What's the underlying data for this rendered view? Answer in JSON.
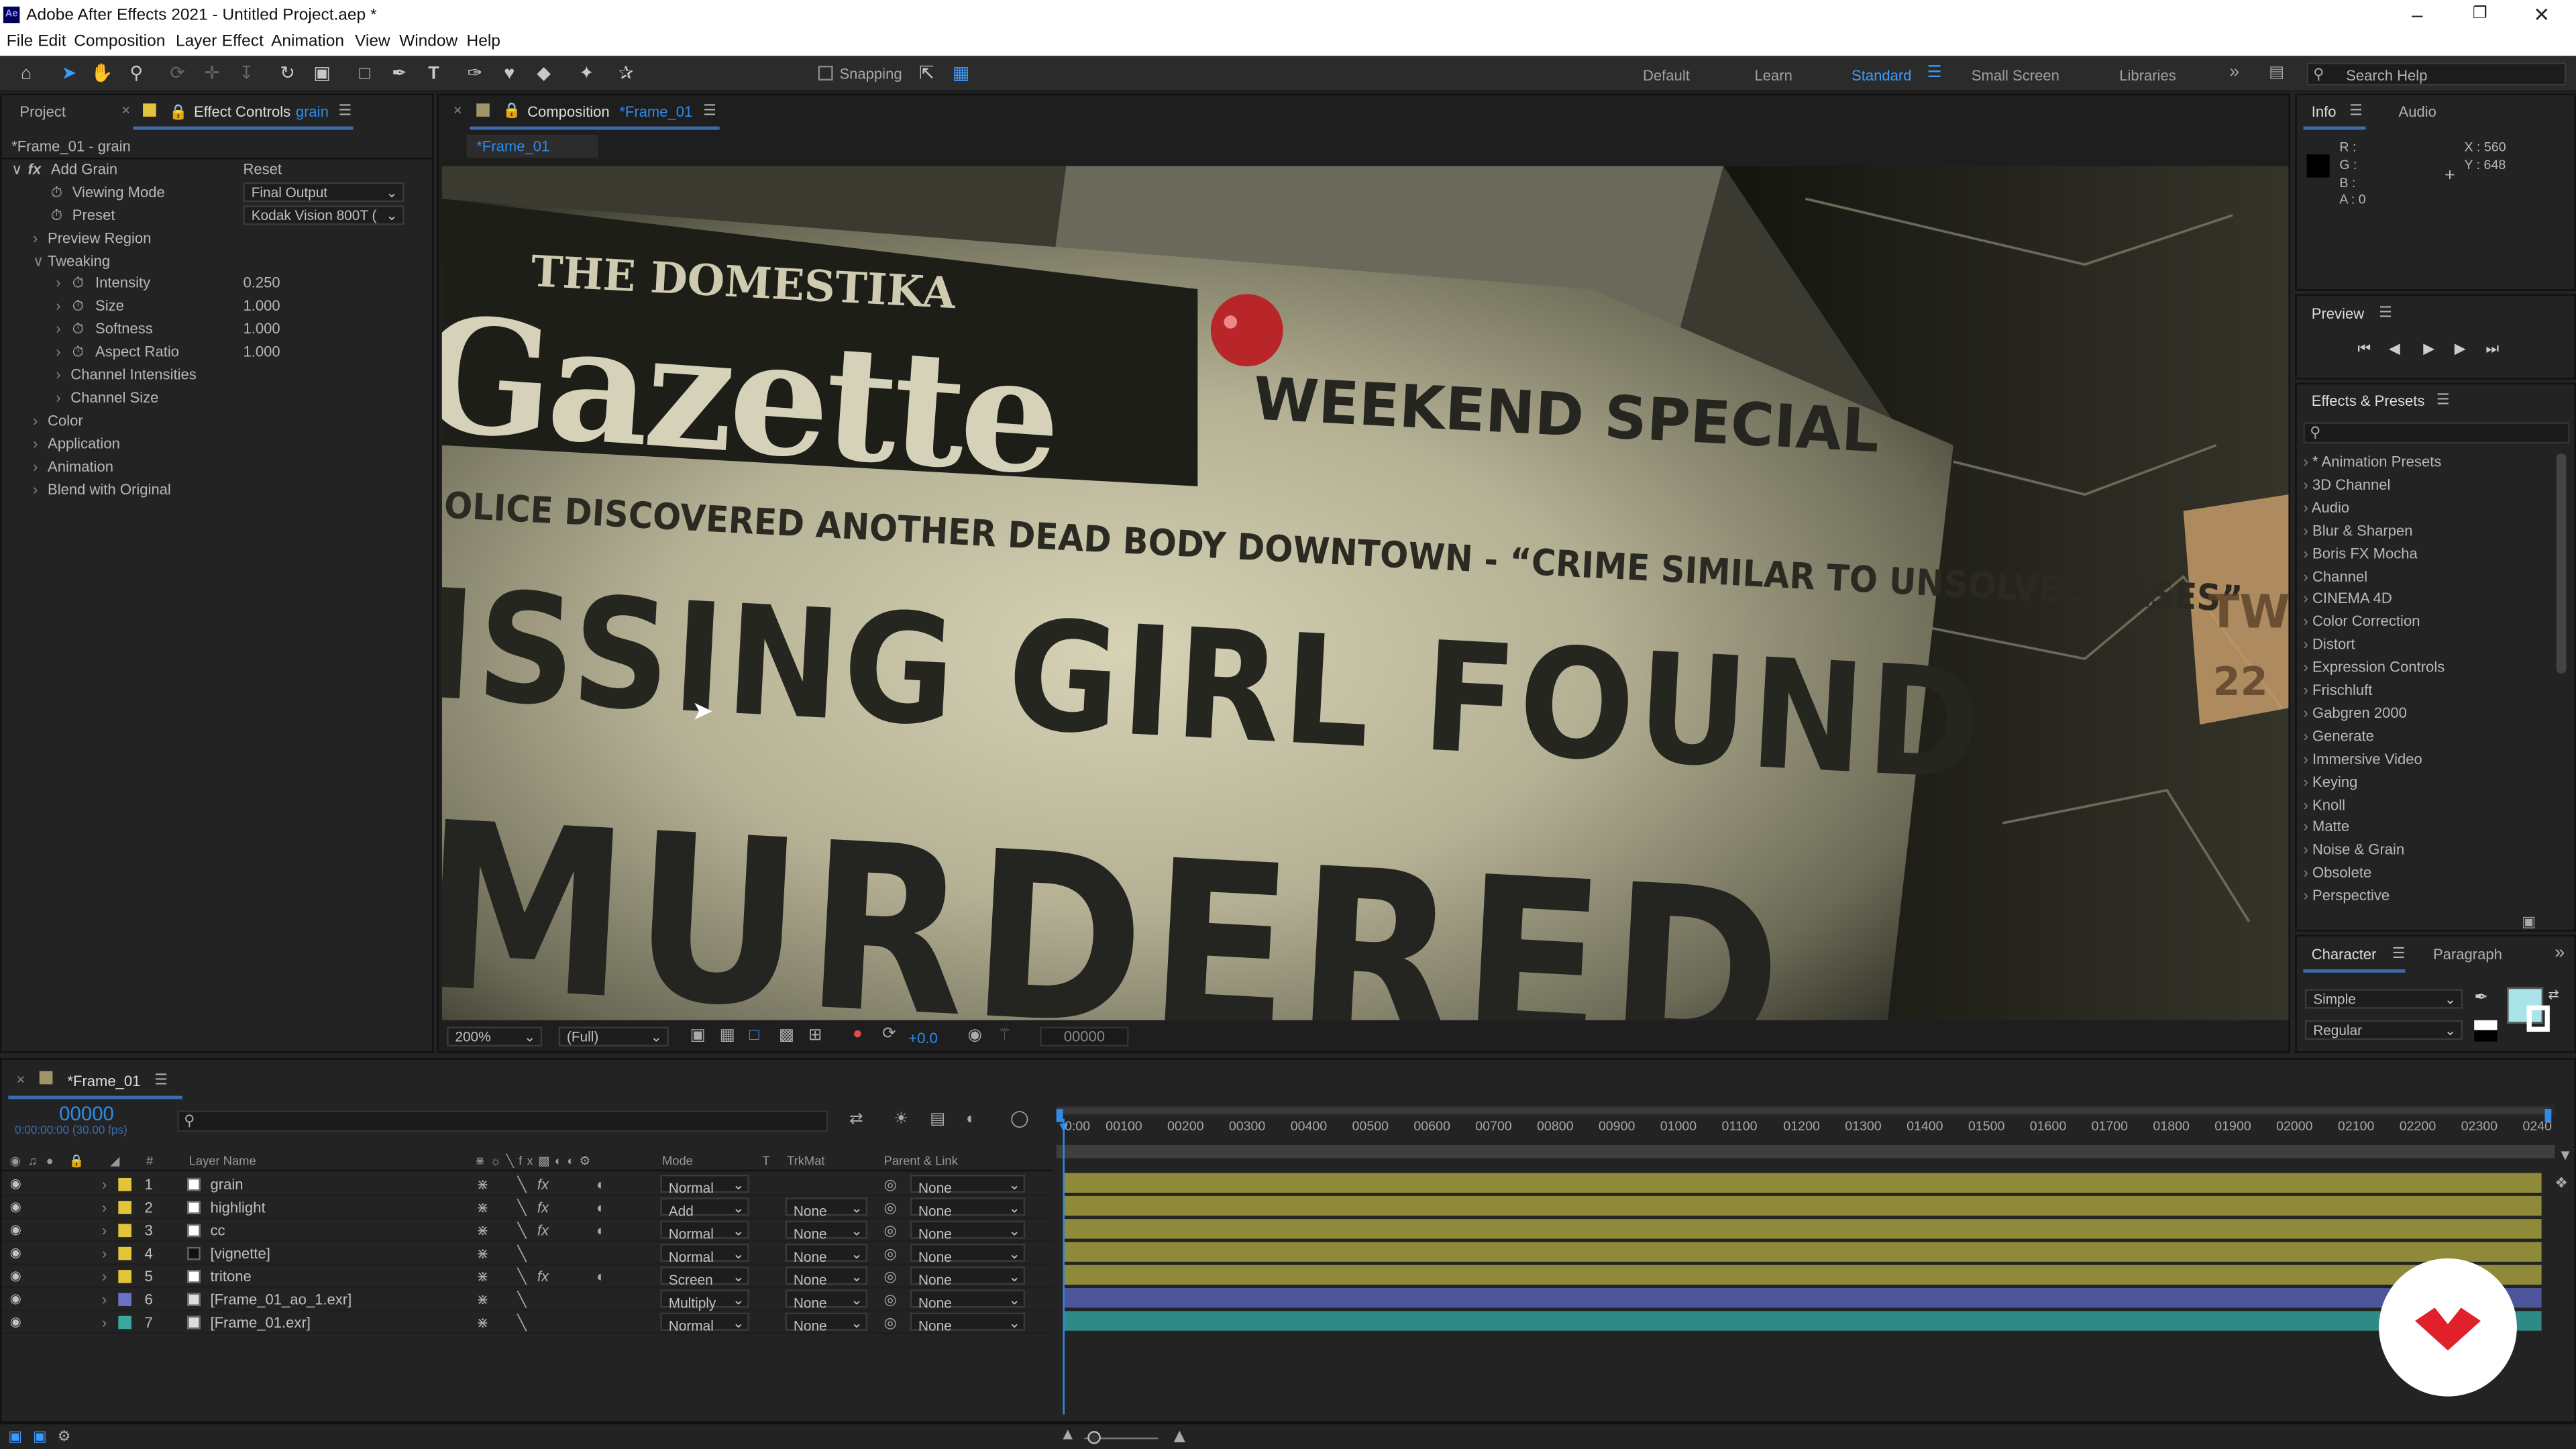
{
  "title": "Adobe After Effects 2021 - Untitled Project.aep *",
  "menu": [
    "File",
    "Edit",
    "Composition",
    "Layer",
    "Effect",
    "Animation",
    "View",
    "Window",
    "Help"
  ],
  "toolbar": {
    "snapping": "Snapping"
  },
  "workspaces": [
    "Default",
    "Learn",
    "Standard",
    "Small Screen",
    "Libraries"
  ],
  "search_help": "Search Help",
  "left_panel": {
    "tab_project": "Project",
    "tab_effect_controls": "Effect Controls",
    "tab_effect_layer": "grain",
    "subtitle": "*Frame_01 - grain",
    "effect_name": "Add Grain",
    "reset": "Reset",
    "viewing_mode_label": "Viewing Mode",
    "viewing_mode_value": "Final Output",
    "preset_label": "Preset",
    "preset_value": "Kodak Vision 800T (",
    "preview_region": "Preview Region",
    "tweaking": "Tweaking",
    "params": [
      {
        "label": "Intensity",
        "value": "0.250"
      },
      {
        "label": "Size",
        "value": "1.000"
      },
      {
        "label": "Softness",
        "value": "1.000"
      },
      {
        "label": "Aspect Ratio",
        "value": "1.000"
      }
    ],
    "channel_intensities": "Channel Intensities",
    "channel_size": "Channel Size",
    "groups": [
      "Color",
      "Application",
      "Animation",
      "Blend with Original"
    ]
  },
  "comp_panel": {
    "label": "Composition",
    "comp_name": "*Frame_01",
    "tab": "*Frame_01",
    "zoom": "200%",
    "quality": "(Full)",
    "exposure": "+0.0",
    "timecode": "00000"
  },
  "viewer_text": {
    "masthead_small": "THE DOMESTIKA",
    "masthead": "Gazette",
    "weekend": "WEEKEND SPECIAL",
    "subhead": "OLICE DISCOVERED ANOTHER DEAD BODY DOWNTOWN - “CRIME SIMILAR TO UNSOLVED CASES”",
    "headline1": "ISSING GIRL FOUND",
    "headline2": "MURDERED",
    "side1": "TW",
    "side2": "22"
  },
  "info_panel": {
    "tab_info": "Info",
    "tab_audio": "Audio",
    "r": "R :",
    "g": "G :",
    "b": "B :",
    "a": "A : 0",
    "x": "X : 560",
    "y": "Y : 648"
  },
  "preview_panel": {
    "title": "Preview"
  },
  "effects_presets": {
    "title": "Effects & Presets",
    "items": [
      "* Animation Presets",
      "3D Channel",
      "Audio",
      "Blur & Sharpen",
      "Boris FX Mocha",
      "Channel",
      "CINEMA 4D",
      "Color Correction",
      "Distort",
      "Expression Controls",
      "Frischluft",
      "Gabgren 2000",
      "Generate",
      "Immersive Video",
      "Keying",
      "Knoll",
      "Matte",
      "Noise & Grain",
      "Obsolete",
      "Perspective"
    ]
  },
  "character_panel": {
    "tab_character": "Character",
    "tab_paragraph": "Paragraph",
    "font": "Simple",
    "style": "Regular"
  },
  "timeline": {
    "tab": "*Frame_01",
    "timecode": "00000",
    "timecode_sub": "0:00:00:00 (30.00 fps)",
    "headers": {
      "num": "#",
      "layer_name": "Layer Name",
      "mode": "Mode",
      "t": "T",
      "trkmat": "TrkMat",
      "parent": "Parent & Link"
    },
    "ruler": [
      "00100",
      "00200",
      "00300",
      "00400",
      "00500",
      "00600",
      "00700",
      "00800",
      "00900",
      "01000",
      "01100",
      "01200",
      "01300",
      "01400",
      "01500",
      "01600",
      "01700",
      "01800",
      "01900",
      "02000",
      "02100",
      "02200",
      "02300",
      "0240"
    ],
    "ruler_start": "0:00",
    "layers": [
      {
        "num": "1",
        "name": "grain",
        "mode": "Normal",
        "trkmat": "",
        "parent": "None",
        "color": "#e2c43a",
        "bar": "#8f8a3a"
      },
      {
        "num": "2",
        "name": "highlight",
        "mode": "Add",
        "trkmat": "None",
        "parent": "None",
        "color": "#e2c43a",
        "bar": "#8f8a3a"
      },
      {
        "num": "3",
        "name": "cc",
        "mode": "Normal",
        "trkmat": "None",
        "parent": "None",
        "color": "#e2c43a",
        "bar": "#8f8a3a"
      },
      {
        "num": "4",
        "name": "[vignette]",
        "mode": "Normal",
        "trkmat": "None",
        "parent": "None",
        "color": "#e2c43a",
        "bar": "#8f8a3a"
      },
      {
        "num": "5",
        "name": "tritone",
        "mode": "Screen",
        "trkmat": "None",
        "parent": "None",
        "color": "#e2c43a",
        "bar": "#8f8a3a"
      },
      {
        "num": "6",
        "name": "[Frame_01_ao_1.exr]",
        "mode": "Multiply",
        "trkmat": "None",
        "parent": "None",
        "color": "#6b72c8",
        "bar": "#4c559a"
      },
      {
        "num": "7",
        "name": "[Frame_01.exr]",
        "mode": "Normal",
        "trkmat": "None",
        "parent": "None",
        "color": "#3aa8a0",
        "bar": "#2f8a85"
      }
    ]
  }
}
